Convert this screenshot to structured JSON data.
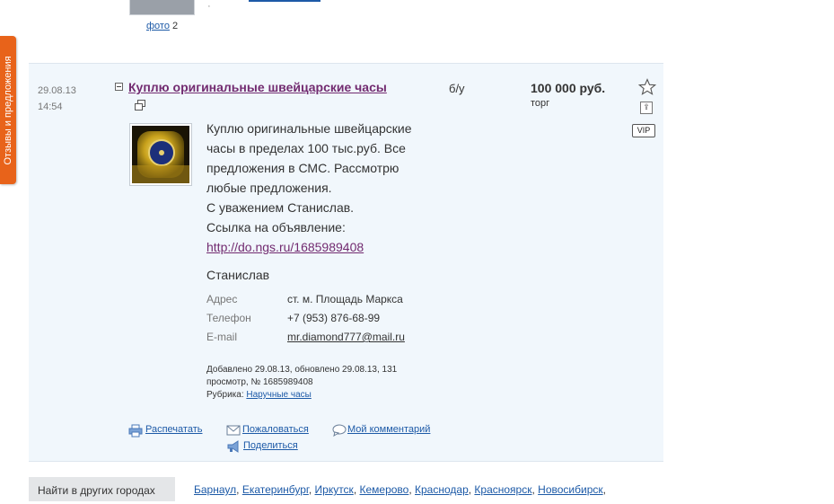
{
  "side_tab": {
    "label": "Отзывы и предложения"
  },
  "previous_listing": {
    "photo_label": "фото",
    "photo_count": "2"
  },
  "listing": {
    "date": "29.08.13",
    "time": "14:54",
    "title": "Куплю оригинальные швейцарские часы",
    "condition": "б/у",
    "price": "100 000 руб.",
    "bargain": "торг",
    "vip_badge": "VIP",
    "description_lines": [
      "Куплю оригинальные швейцарские",
      "часы в пределах 100 тыс.руб. Все",
      "предложения в СМС. Рассмотрю",
      "любые предложения.",
      "С уважением Станислав.",
      "Ссылка на объявление:"
    ],
    "description_link": "http://do.ngs.ru/1685989408",
    "seller_name": "Станислав",
    "info": [
      {
        "label": "Адрес",
        "value": "ст. м. Площадь Маркса"
      },
      {
        "label": "Телефон",
        "value": "+7 (953) 876-68-99"
      },
      {
        "label": "E-mail",
        "value": "mr.diamond777@mail.ru"
      }
    ],
    "meta_line1": "Добавлено 29.08.13, обновлено 29.08.13, 131",
    "meta_line2": "просмотр, № 1685989408",
    "rubric_label": "Рубрика:",
    "rubric_link": "Наручные часы"
  },
  "actions": {
    "print": "Распечатать",
    "complain": "Пожаловаться",
    "comment": "Мой комментарий",
    "share": "Поделиться"
  },
  "other_cities": {
    "label": "Найти в других городах",
    "cities": [
      "Барнаул",
      "Екатеринбург",
      "Иркутск",
      "Кемерово",
      "Краснодар",
      "Красноярск",
      "Новосибирск"
    ]
  },
  "colors": {
    "link": "#1d5aa7",
    "title": "#722b70",
    "tab": "#e8631a",
    "card_bg": "#f1f7fc"
  }
}
